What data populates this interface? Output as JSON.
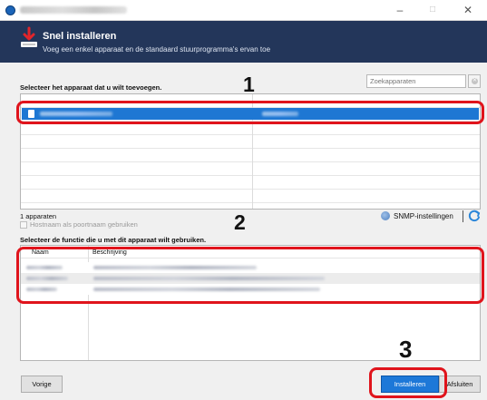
{
  "window": {
    "icon": "app-globe-icon",
    "controls": {
      "minimize": "–",
      "maximize": "□",
      "close": "✕"
    }
  },
  "header": {
    "icon": "download-arrow-icon",
    "title": "Snel installeren",
    "subtitle": "Voeg een enkel apparaat en de standaard stuurprogramma's ervan toe"
  },
  "device_section": {
    "label": "Selecteer het apparaat dat u wilt toevoegen.",
    "search_placeholder": "Zoekapparaten",
    "step_number": "1",
    "count": "1 apparaten",
    "hostname_checkbox_label": "Hostnaam als poortnaam gebruiken",
    "snmp_label": "SNMP-instellingen"
  },
  "function_section": {
    "label": "Selecteer de functie die u met dit apparaat wilt gebruiken.",
    "step_number": "2",
    "columns": {
      "name": "Naam",
      "description": "Beschrijving"
    }
  },
  "footer": {
    "step_number": "3",
    "prev_label": "Vorige",
    "install_label": "Installeren",
    "close_label": "Afsluiten"
  },
  "colors": {
    "header_bg": "#23365a",
    "selection": "#1e77d3",
    "highlight_box": "#e0141c",
    "install_button": "#1d78d8"
  }
}
